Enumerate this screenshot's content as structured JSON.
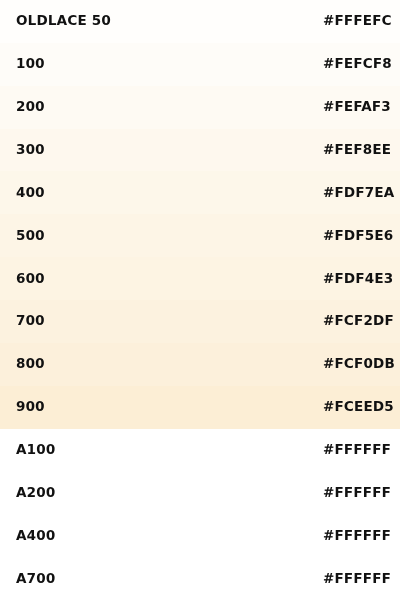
{
  "palette": {
    "rows": [
      {
        "name": "OLDLACE 50",
        "hex": "#FFFEFC",
        "color": "#FFFEFC"
      },
      {
        "name": "100",
        "hex": "#FEFCF8",
        "color": "#FEFCF8"
      },
      {
        "name": "200",
        "hex": "#FEFAF3",
        "color": "#FEFAF3"
      },
      {
        "name": "300",
        "hex": "#FEF8EE",
        "color": "#FEF8EE"
      },
      {
        "name": "400",
        "hex": "#FDF7EA",
        "color": "#FDF7EA"
      },
      {
        "name": "500",
        "hex": "#FDF5E6",
        "color": "#FDF5E6"
      },
      {
        "name": "600",
        "hex": "#FDF4E3",
        "color": "#FDF4E3"
      },
      {
        "name": "700",
        "hex": "#FCF2DF",
        "color": "#FCF2DF"
      },
      {
        "name": "800",
        "hex": "#FCF0DB",
        "color": "#FCF0DB"
      },
      {
        "name": "900",
        "hex": "#FCEED5",
        "color": "#FCEED5"
      },
      {
        "name": "A100",
        "hex": "#FFFFFF",
        "color": "#FFFFFF"
      },
      {
        "name": "A200",
        "hex": "#FFFFFF",
        "color": "#FFFFFF"
      },
      {
        "name": "A400",
        "hex": "#FFFFFF",
        "color": "#FFFFFF"
      },
      {
        "name": "A700",
        "hex": "#FFFFFF",
        "color": "#FFFFFF"
      }
    ]
  }
}
